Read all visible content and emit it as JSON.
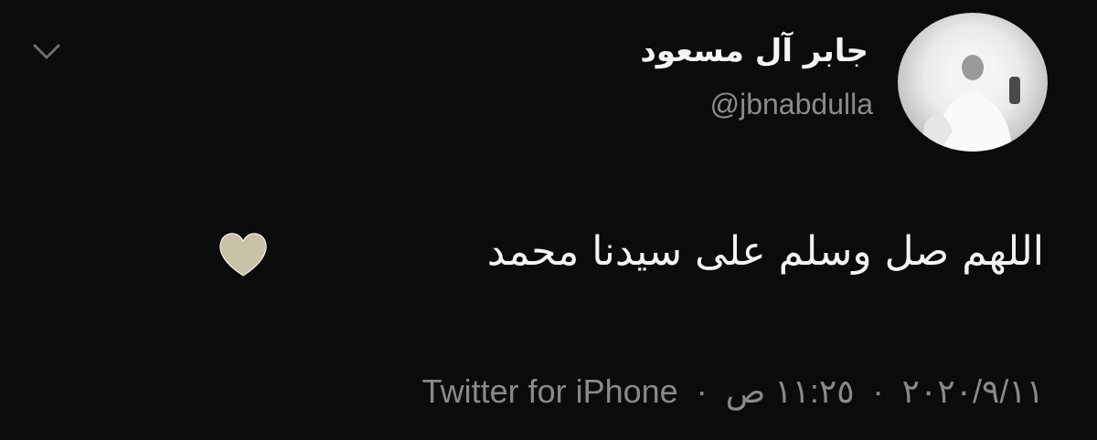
{
  "tweet": {
    "author_name": "جابر آل مسعود",
    "handle": "@jbnabdulla",
    "text": "اللهم صل وسلم على سيدنا محمد",
    "emoji": "heart-icon",
    "source": "Twitter for iPhone",
    "time": "١١:٢٥ ص",
    "date": "٢٠٢٠/٩/١١",
    "separator": "·"
  },
  "colors": {
    "background": "#0b0b0b",
    "primary_text": "#f4f4f4",
    "secondary_text": "#8b8b8b",
    "heart": "#c9c1a8"
  }
}
